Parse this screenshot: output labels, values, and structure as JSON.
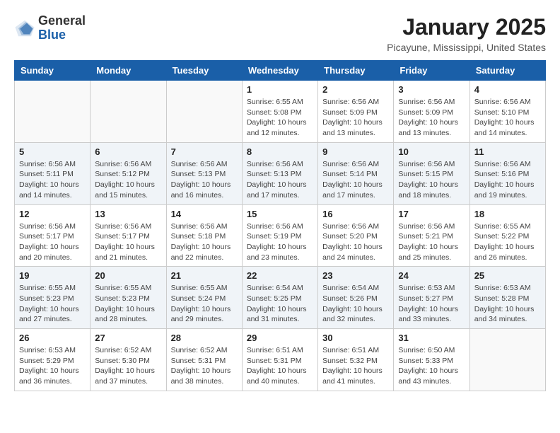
{
  "logo": {
    "general": "General",
    "blue": "Blue"
  },
  "title": "January 2025",
  "subtitle": "Picayune, Mississippi, United States",
  "headers": [
    "Sunday",
    "Monday",
    "Tuesday",
    "Wednesday",
    "Thursday",
    "Friday",
    "Saturday"
  ],
  "weeks": [
    [
      {
        "day": "",
        "info": ""
      },
      {
        "day": "",
        "info": ""
      },
      {
        "day": "",
        "info": ""
      },
      {
        "day": "1",
        "info": "Sunrise: 6:55 AM\nSunset: 5:08 PM\nDaylight: 10 hours\nand 12 minutes."
      },
      {
        "day": "2",
        "info": "Sunrise: 6:56 AM\nSunset: 5:09 PM\nDaylight: 10 hours\nand 13 minutes."
      },
      {
        "day": "3",
        "info": "Sunrise: 6:56 AM\nSunset: 5:09 PM\nDaylight: 10 hours\nand 13 minutes."
      },
      {
        "day": "4",
        "info": "Sunrise: 6:56 AM\nSunset: 5:10 PM\nDaylight: 10 hours\nand 14 minutes."
      }
    ],
    [
      {
        "day": "5",
        "info": "Sunrise: 6:56 AM\nSunset: 5:11 PM\nDaylight: 10 hours\nand 14 minutes."
      },
      {
        "day": "6",
        "info": "Sunrise: 6:56 AM\nSunset: 5:12 PM\nDaylight: 10 hours\nand 15 minutes."
      },
      {
        "day": "7",
        "info": "Sunrise: 6:56 AM\nSunset: 5:13 PM\nDaylight: 10 hours\nand 16 minutes."
      },
      {
        "day": "8",
        "info": "Sunrise: 6:56 AM\nSunset: 5:13 PM\nDaylight: 10 hours\nand 17 minutes."
      },
      {
        "day": "9",
        "info": "Sunrise: 6:56 AM\nSunset: 5:14 PM\nDaylight: 10 hours\nand 17 minutes."
      },
      {
        "day": "10",
        "info": "Sunrise: 6:56 AM\nSunset: 5:15 PM\nDaylight: 10 hours\nand 18 minutes."
      },
      {
        "day": "11",
        "info": "Sunrise: 6:56 AM\nSunset: 5:16 PM\nDaylight: 10 hours\nand 19 minutes."
      }
    ],
    [
      {
        "day": "12",
        "info": "Sunrise: 6:56 AM\nSunset: 5:17 PM\nDaylight: 10 hours\nand 20 minutes."
      },
      {
        "day": "13",
        "info": "Sunrise: 6:56 AM\nSunset: 5:17 PM\nDaylight: 10 hours\nand 21 minutes."
      },
      {
        "day": "14",
        "info": "Sunrise: 6:56 AM\nSunset: 5:18 PM\nDaylight: 10 hours\nand 22 minutes."
      },
      {
        "day": "15",
        "info": "Sunrise: 6:56 AM\nSunset: 5:19 PM\nDaylight: 10 hours\nand 23 minutes."
      },
      {
        "day": "16",
        "info": "Sunrise: 6:56 AM\nSunset: 5:20 PM\nDaylight: 10 hours\nand 24 minutes."
      },
      {
        "day": "17",
        "info": "Sunrise: 6:56 AM\nSunset: 5:21 PM\nDaylight: 10 hours\nand 25 minutes."
      },
      {
        "day": "18",
        "info": "Sunrise: 6:55 AM\nSunset: 5:22 PM\nDaylight: 10 hours\nand 26 minutes."
      }
    ],
    [
      {
        "day": "19",
        "info": "Sunrise: 6:55 AM\nSunset: 5:23 PM\nDaylight: 10 hours\nand 27 minutes."
      },
      {
        "day": "20",
        "info": "Sunrise: 6:55 AM\nSunset: 5:23 PM\nDaylight: 10 hours\nand 28 minutes."
      },
      {
        "day": "21",
        "info": "Sunrise: 6:55 AM\nSunset: 5:24 PM\nDaylight: 10 hours\nand 29 minutes."
      },
      {
        "day": "22",
        "info": "Sunrise: 6:54 AM\nSunset: 5:25 PM\nDaylight: 10 hours\nand 31 minutes."
      },
      {
        "day": "23",
        "info": "Sunrise: 6:54 AM\nSunset: 5:26 PM\nDaylight: 10 hours\nand 32 minutes."
      },
      {
        "day": "24",
        "info": "Sunrise: 6:53 AM\nSunset: 5:27 PM\nDaylight: 10 hours\nand 33 minutes."
      },
      {
        "day": "25",
        "info": "Sunrise: 6:53 AM\nSunset: 5:28 PM\nDaylight: 10 hours\nand 34 minutes."
      }
    ],
    [
      {
        "day": "26",
        "info": "Sunrise: 6:53 AM\nSunset: 5:29 PM\nDaylight: 10 hours\nand 36 minutes."
      },
      {
        "day": "27",
        "info": "Sunrise: 6:52 AM\nSunset: 5:30 PM\nDaylight: 10 hours\nand 37 minutes."
      },
      {
        "day": "28",
        "info": "Sunrise: 6:52 AM\nSunset: 5:31 PM\nDaylight: 10 hours\nand 38 minutes."
      },
      {
        "day": "29",
        "info": "Sunrise: 6:51 AM\nSunset: 5:31 PM\nDaylight: 10 hours\nand 40 minutes."
      },
      {
        "day": "30",
        "info": "Sunrise: 6:51 AM\nSunset: 5:32 PM\nDaylight: 10 hours\nand 41 minutes."
      },
      {
        "day": "31",
        "info": "Sunrise: 6:50 AM\nSunset: 5:33 PM\nDaylight: 10 hours\nand 43 minutes."
      },
      {
        "day": "",
        "info": ""
      }
    ]
  ]
}
